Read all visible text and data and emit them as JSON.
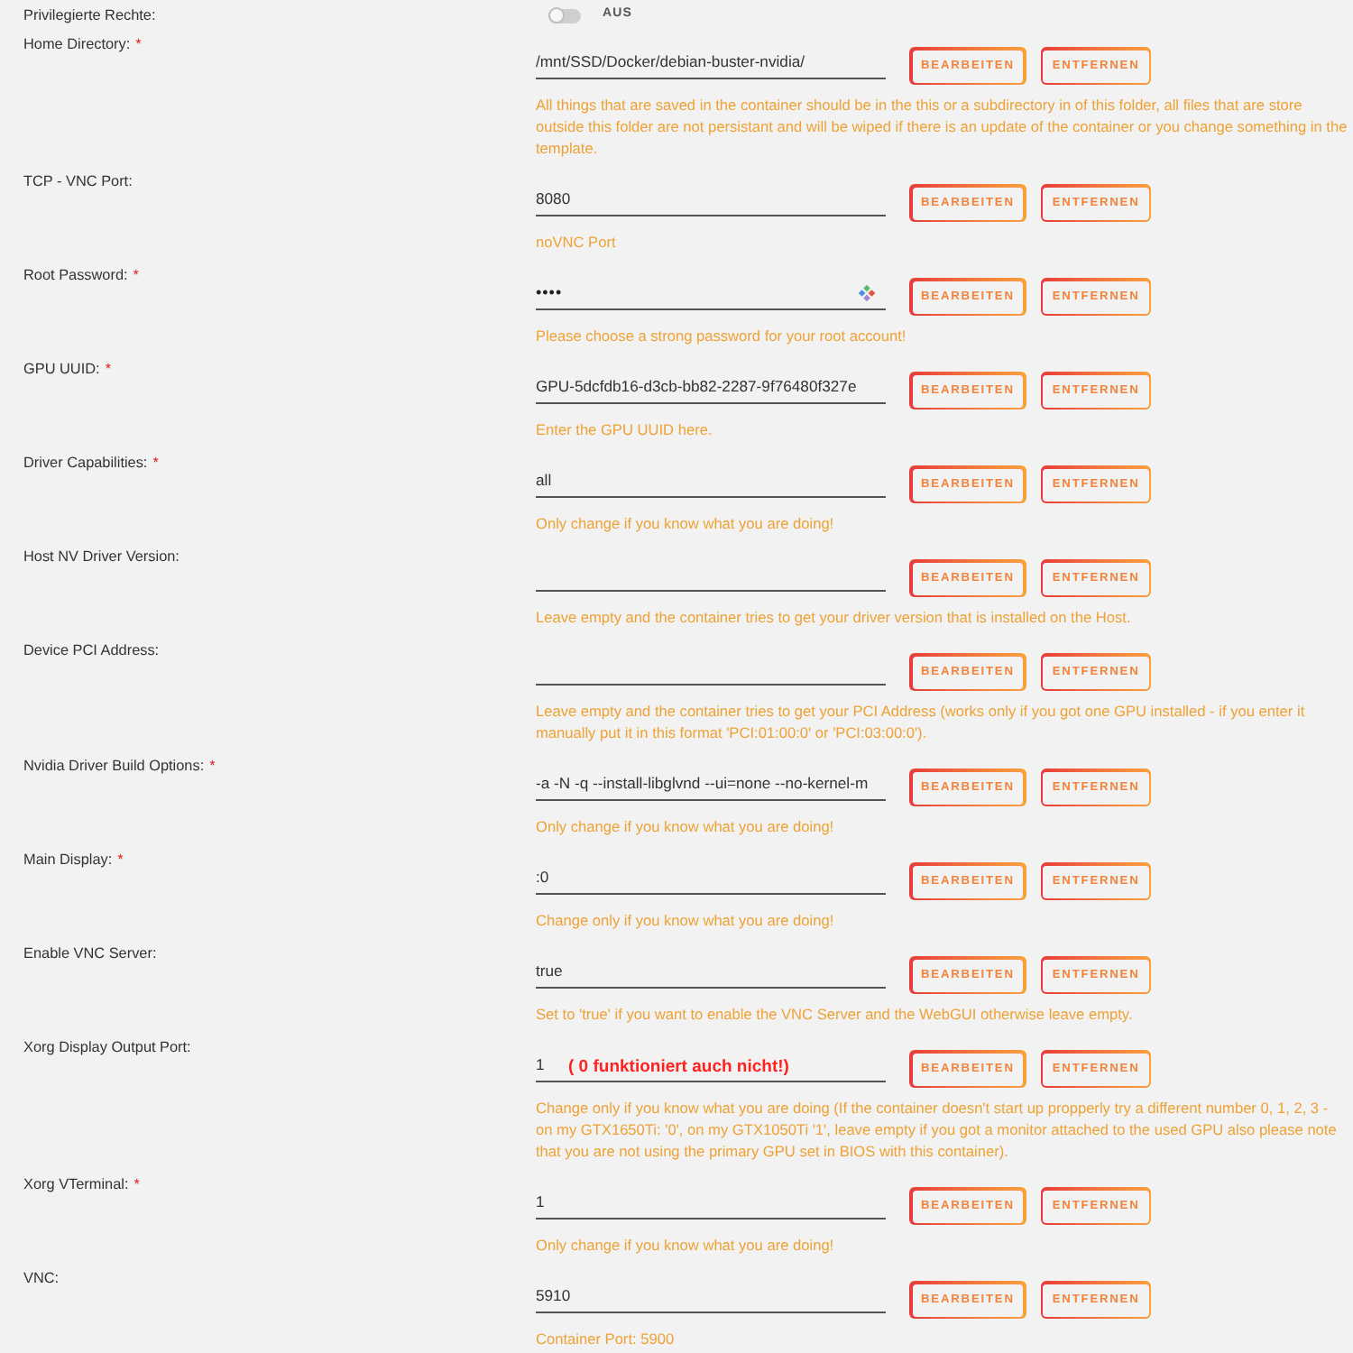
{
  "settings": [
    {
      "kind": "toggle",
      "label": "Privilegierte Rechte:",
      "on": false,
      "state_text": "AUS"
    },
    {
      "kind": "text",
      "label": "Home Directory:",
      "required_mark": "*",
      "value": "/mnt/SSD/Docker/debian-buster-nvidia/",
      "buttons": [
        "BEARBEITEN",
        "ENTFERNEN"
      ],
      "hint": "All things that are saved in the container should be in the this or a subdirectory in of this folder, all files that are store outside this folder are not persistant and will be wiped if there is an update of the container or you change something in the template."
    },
    {
      "kind": "text",
      "label": "TCP - VNC Port:",
      "value": "8080",
      "buttons": [
        "BEARBEITEN",
        "ENTFERNEN"
      ],
      "hint": "noVNC Port"
    },
    {
      "kind": "password",
      "label": "Root Password:",
      "required_mark": "*",
      "value": "••••",
      "buttons": [
        "BEARBEITEN",
        "ENTFERNEN"
      ],
      "hint": "Please choose a strong password for your root account!"
    },
    {
      "kind": "text",
      "label": "GPU UUID:",
      "required_mark": "*",
      "value": "GPU-5dcfdb16-d3cb-bb82-2287-9f76480f327e",
      "buttons": [
        "BEARBEITEN",
        "ENTFERNEN"
      ],
      "hint": "Enter the GPU UUID here."
    },
    {
      "kind": "text",
      "label": "Driver Capabilities:",
      "required_mark": "*",
      "value": "all",
      "buttons": [
        "BEARBEITEN",
        "ENTFERNEN"
      ],
      "hint": "Only change if you know what you are doing!"
    },
    {
      "kind": "text",
      "label": "Host NV Driver Version:",
      "buttons": [
        "BEARBEITEN",
        "ENTFERNEN"
      ],
      "hint": "Leave empty and the container tries to get your driver version that is installed on the Host."
    },
    {
      "kind": "text",
      "label": "Device PCI Address:",
      "buttons": [
        "BEARBEITEN",
        "ENTFERNEN"
      ],
      "hint": "Leave empty and the container tries to get your PCI Address (works only if you got one GPU installed - if you enter it manually put it in this format 'PCI:01:00:0' or 'PCI:03:00:0')."
    },
    {
      "kind": "text",
      "label": "Nvidia Driver Build Options:",
      "required_mark": "*",
      "value": "-a -N -q --install-libglvnd --ui=none --no-kernel-m",
      "buttons": [
        "BEARBEITEN",
        "ENTFERNEN"
      ],
      "hint": "Only change if you know what you are doing!"
    },
    {
      "kind": "text",
      "label": "Main Display:",
      "required_mark": "*",
      "value": ":0",
      "buttons": [
        "BEARBEITEN",
        "ENTFERNEN"
      ],
      "hint": "Change only if you know what you are doing!"
    },
    {
      "kind": "text",
      "label": "Enable VNC Server:",
      "value": "true",
      "buttons": [
        "BEARBEITEN",
        "ENTFERNEN"
      ],
      "hint": "Set to 'true' if you want to enable the VNC Server and the WebGUI otherwise leave empty."
    },
    {
      "kind": "text",
      "label": "Xorg Display Output Port:",
      "value": "1",
      "annotation": "( 0 funktioniert auch nicht!)",
      "buttons": [
        "BEARBEITEN",
        "ENTFERNEN"
      ],
      "hint": "Change only if you know what you are doing (If the container doesn't start up propperly try a different number 0, 1, 2, 3 - on my GTX1650Ti: '0', on my GTX1050Ti '1', leave empty if you got a monitor attached to the used GPU also please note that you are not using the primary GPU set in BIOS with this container)."
    },
    {
      "kind": "text",
      "label": "Xorg VTerminal:",
      "required_mark": "*",
      "value": "1",
      "buttons": [
        "BEARBEITEN",
        "ENTFERNEN"
      ],
      "hint": "Only change if you know what you are doing!"
    },
    {
      "kind": "text",
      "label": "VNC:",
      "value": "5910",
      "buttons": [
        "BEARBEITEN",
        "ENTFERNEN"
      ],
      "hint": "Container Port: 5900"
    }
  ]
}
